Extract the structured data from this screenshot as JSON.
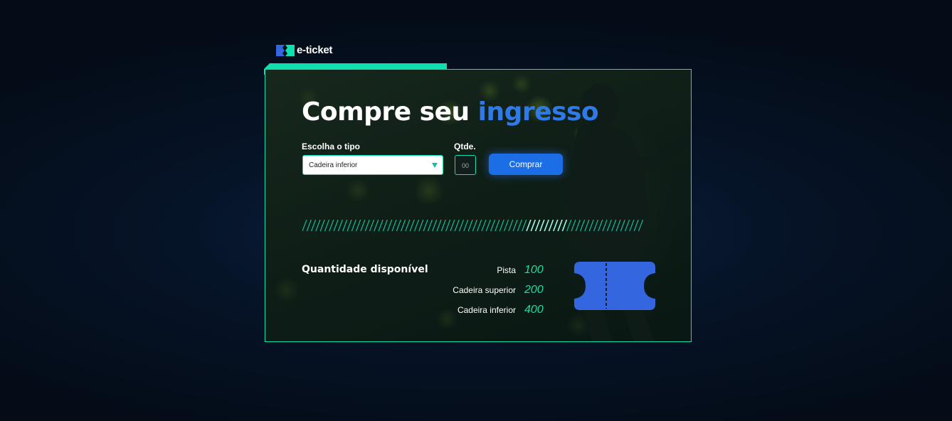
{
  "brand": {
    "name": "e-ticket",
    "colors": {
      "accent": "#10e0b0",
      "primary": "#1c6ee6",
      "ticket": "#3466e0"
    }
  },
  "form": {
    "title_main": "Compre seu",
    "title_accent": "ingresso",
    "type_label": "Escolha o tipo",
    "type_selected": "Cadeira inferior",
    "qty_label": "Qtde.",
    "qty_placeholder": "00",
    "buy_label": "Comprar"
  },
  "availability": {
    "title": "Quantidade disponível",
    "items": [
      {
        "name": "Pista",
        "value": "100"
      },
      {
        "name": "Cadeira superior",
        "value": "200"
      },
      {
        "name": "Cadeira inferior",
        "value": "400"
      }
    ]
  },
  "icons": {
    "logo": "ticket-logo-icon",
    "caret": "chevron-down-icon",
    "ticket": "ticket-icon"
  }
}
